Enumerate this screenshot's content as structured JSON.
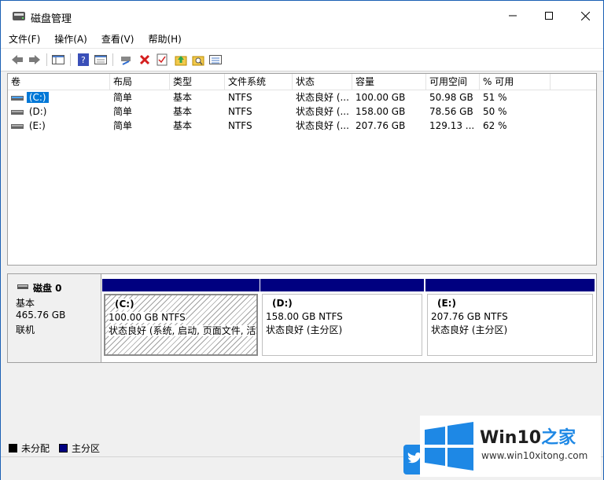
{
  "window": {
    "title": "磁盘管理"
  },
  "menu": [
    "文件(F)",
    "操作(A)",
    "查看(V)",
    "帮助(H)"
  ],
  "columns": [
    "卷",
    "布局",
    "类型",
    "文件系统",
    "状态",
    "容量",
    "可用空间",
    "% 可用"
  ],
  "volumes": [
    {
      "name": "(C:)",
      "layout": "简单",
      "type": "基本",
      "fs": "NTFS",
      "status": "状态良好 (...",
      "capacity": "100.00 GB",
      "free": "50.98 GB",
      "pct": "51 %"
    },
    {
      "name": "(D:)",
      "layout": "简单",
      "type": "基本",
      "fs": "NTFS",
      "status": "状态良好 (...",
      "capacity": "158.00 GB",
      "free": "78.56 GB",
      "pct": "50 %"
    },
    {
      "name": "(E:)",
      "layout": "简单",
      "type": "基本",
      "fs": "NTFS",
      "status": "状态良好 (...",
      "capacity": "207.76 GB",
      "free": "129.13 ...",
      "pct": "62 %"
    }
  ],
  "disk": {
    "name": "磁盘 0",
    "kind": "基本",
    "size": "465.76 GB",
    "state": "联机"
  },
  "partitions": [
    {
      "label": "(C:)",
      "size": "100.00 GB NTFS",
      "status": "状态良好 (系统, 启动, 页面文件, 活"
    },
    {
      "label": "(D:)",
      "size": "158.00 GB NTFS",
      "status": "状态良好 (主分区)"
    },
    {
      "label": "(E:)",
      "size": "207.76 GB NTFS",
      "status": "状态良好 (主分区)"
    }
  ],
  "legend": {
    "unallocated": "未分配",
    "primary": "主分区"
  },
  "colors": {
    "primary_partition": "#000080",
    "unallocated": "#000000",
    "selection": "#0078d7"
  },
  "watermark": {
    "brand": "Win10",
    "brand_suffix": "之家",
    "url": "www.win10xitong.com"
  }
}
